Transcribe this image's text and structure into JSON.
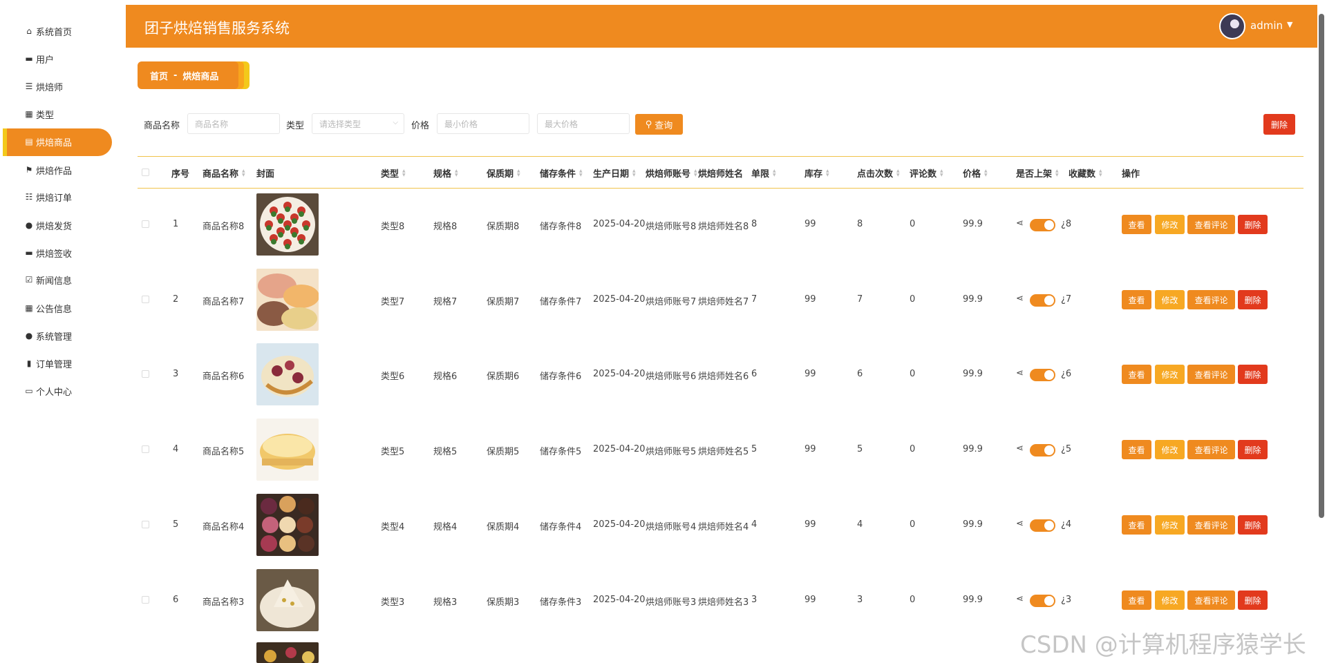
{
  "app": {
    "title": "团子烘焙销售服务系统",
    "user": "admin"
  },
  "sidebar": {
    "items": [
      {
        "label": "系统首页",
        "icon": "home-icon"
      },
      {
        "label": "用户",
        "icon": "monitor-icon"
      },
      {
        "label": "烘焙师",
        "icon": "list-icon"
      },
      {
        "label": "类型",
        "icon": "grid-icon"
      },
      {
        "label": "烘焙商品",
        "icon": "clipboard-icon",
        "active": true
      },
      {
        "label": "烘焙作品",
        "icon": "flag-icon"
      },
      {
        "label": "烘焙订单",
        "icon": "sliders-icon"
      },
      {
        "label": "烘焙发货",
        "icon": "person-icon"
      },
      {
        "label": "烘焙签收",
        "icon": "monitor-icon"
      },
      {
        "label": "新闻信息",
        "icon": "clipboard-check-icon"
      },
      {
        "label": "公告信息",
        "icon": "grid-icon"
      },
      {
        "label": "系统管理",
        "icon": "person-icon"
      },
      {
        "label": "订单管理",
        "icon": "bar-chart-icon"
      },
      {
        "label": "个人中心",
        "icon": "card-icon"
      }
    ]
  },
  "breadcrumb": {
    "home": "首页",
    "separator": "-",
    "current": "烘焙商品"
  },
  "search": {
    "name_label": "商品名称",
    "name_placeholder": "商品名称",
    "type_label": "类型",
    "type_placeholder": "请选择类型",
    "price_label": "价格",
    "min_placeholder": "最小价格",
    "max_placeholder": "最大价格",
    "query_button": "查询",
    "delete_button": "删除"
  },
  "table": {
    "headers": [
      "序号",
      "商品名称",
      "封面",
      "类型",
      "规格",
      "保质期",
      "储存条件",
      "生产日期",
      "烘焙师账号",
      "烘焙师姓名",
      "单限",
      "库存",
      "点击次数",
      "评论数",
      "价格",
      "是否上架",
      "收藏数",
      "操作"
    ],
    "ops": {
      "view": "查看",
      "edit": "修改",
      "comments": "查看评论",
      "delete": "删除"
    },
    "rows": [
      {
        "no": "1",
        "name": "商品名称8",
        "type": "类型8",
        "spec": "规格8",
        "shelf": "保质期8",
        "storage": "储存条件8",
        "date": "2025-04-20",
        "baker_acc": "烘焙师账号8",
        "baker_name": "烘焙师姓名8",
        "limit": "8",
        "stock": "99",
        "clicks": "8",
        "comments": "0",
        "price": "99.9",
        "favs": "8"
      },
      {
        "no": "2",
        "name": "商品名称7",
        "type": "类型7",
        "spec": "规格7",
        "shelf": "保质期7",
        "storage": "储存条件7",
        "date": "2025-04-20",
        "baker_acc": "烘焙师账号7",
        "baker_name": "烘焙师姓名7",
        "limit": "7",
        "stock": "99",
        "clicks": "7",
        "comments": "0",
        "price": "99.9",
        "favs": "7"
      },
      {
        "no": "3",
        "name": "商品名称6",
        "type": "类型6",
        "spec": "规格6",
        "shelf": "保质期6",
        "storage": "储存条件6",
        "date": "2025-04-20",
        "baker_acc": "烘焙师账号6",
        "baker_name": "烘焙师姓名6",
        "limit": "6",
        "stock": "99",
        "clicks": "6",
        "comments": "0",
        "price": "99.9",
        "favs": "6"
      },
      {
        "no": "4",
        "name": "商品名称5",
        "type": "类型5",
        "spec": "规格5",
        "shelf": "保质期5",
        "storage": "储存条件5",
        "date": "2025-04-20",
        "baker_acc": "烘焙师账号5",
        "baker_name": "烘焙师姓名5",
        "limit": "5",
        "stock": "99",
        "clicks": "5",
        "comments": "0",
        "price": "99.9",
        "favs": "5"
      },
      {
        "no": "5",
        "name": "商品名称4",
        "type": "类型4",
        "spec": "规格4",
        "shelf": "保质期4",
        "storage": "储存条件4",
        "date": "2025-04-20",
        "baker_acc": "烘焙师账号4",
        "baker_name": "烘焙师姓名4",
        "limit": "4",
        "stock": "99",
        "clicks": "4",
        "comments": "0",
        "price": "99.9",
        "favs": "4"
      },
      {
        "no": "6",
        "name": "商品名称3",
        "type": "类型3",
        "spec": "规格3",
        "shelf": "保质期3",
        "storage": "储存条件3",
        "date": "2025-04-20",
        "baker_acc": "烘焙师账号3",
        "baker_name": "烘焙师姓名3",
        "limit": "3",
        "stock": "99",
        "clicks": "3",
        "comments": "0",
        "price": "99.9",
        "favs": "3"
      }
    ]
  },
  "watermark": "CSDN @计算机程序猿学长",
  "colors": {
    "primary": "#ef8a1f",
    "secondary": "#f7a823",
    "danger": "#e23a1d",
    "accent": "#f3c91b"
  }
}
